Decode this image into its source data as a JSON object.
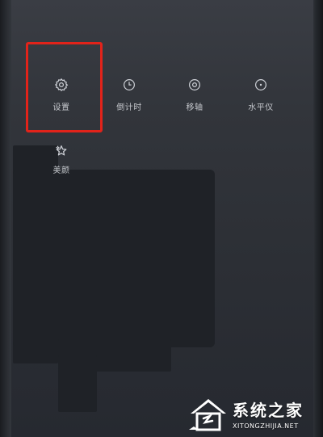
{
  "menu": {
    "items": [
      {
        "label": "设置",
        "icon": "gear-icon"
      },
      {
        "label": "倒计时",
        "icon": "timer-icon"
      },
      {
        "label": "移轴",
        "icon": "tilt-shift-icon"
      },
      {
        "label": "水平仪",
        "icon": "level-icon"
      },
      {
        "label": "美颜",
        "icon": "beauty-sparkle-icon"
      }
    ]
  },
  "watermark": {
    "title": "系统之家",
    "subtitle": "XITONGZHIJIA.NET"
  },
  "colors": {
    "highlight": "#e2231a",
    "icon": "#cfd2d8",
    "background": "#2b2e34"
  }
}
